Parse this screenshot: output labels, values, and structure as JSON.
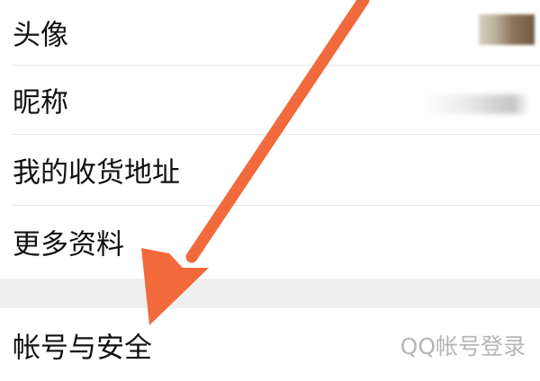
{
  "rows": {
    "avatar": {
      "label": "头像"
    },
    "nickname": {
      "label": "昵称"
    },
    "address": {
      "label": "我的收货地址"
    },
    "more": {
      "label": "更多资料"
    },
    "account": {
      "label": "帐号与安全",
      "value": "QQ帐号登录"
    }
  },
  "colors": {
    "arrow": "#f2693c",
    "section_gap": "#efefef",
    "value_text": "#b5b5b5"
  },
  "icons": {
    "chevron": "chevron-right-icon",
    "overlay": "annotation-arrow-icon"
  }
}
